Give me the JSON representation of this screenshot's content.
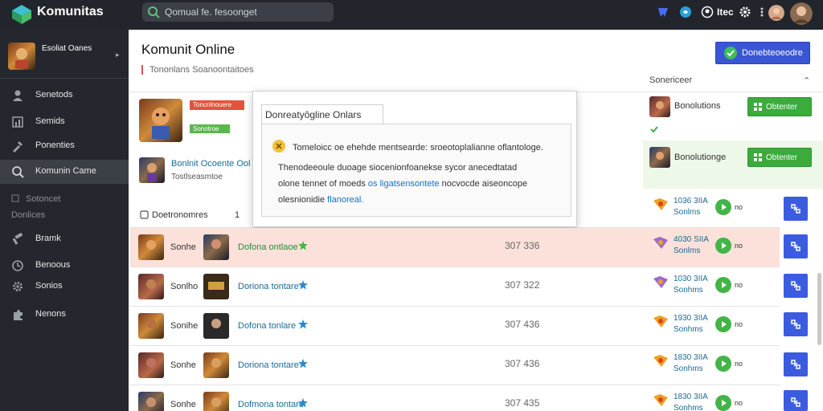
{
  "app": {
    "title": "Komunitas",
    "accent": "#3a56d4"
  },
  "search": {
    "placeholder": "Qomual fe. fesoonget"
  },
  "topbar": {
    "label": "Itec",
    "icons": [
      "logo-icon",
      "search-icon",
      "bookmark-icon",
      "chat-icon",
      "user-icon",
      "gear-icon",
      "avatar"
    ]
  },
  "sidebar": {
    "user": {
      "name": "Esoliat Oanes"
    },
    "items": [
      {
        "label": "Senetods",
        "icon": "person-icon"
      },
      {
        "label": "Semids",
        "icon": "chart-icon"
      },
      {
        "label": "Ponenties",
        "icon": "tools-icon"
      },
      {
        "label": "Komunin Came",
        "icon": "game-icon",
        "active": true
      }
    ],
    "section": {
      "title": "Sotoncet",
      "sub": "Donlices"
    },
    "items2": [
      {
        "label": "Bramk",
        "icon": "hammer-icon"
      },
      {
        "label": "Benoous",
        "icon": "clock-icon"
      },
      {
        "label": "Sonios",
        "icon": "gear-icon"
      },
      {
        "label": "Nenons",
        "icon": "puzzle-icon"
      }
    ]
  },
  "main": {
    "title": "Komunit Online",
    "subtitle": "Tononlans Soanoontaitoes",
    "primary_button": "Donebteoeodre",
    "right_label": "Sonericeer",
    "featured": {
      "badge1": "Toncnlnouere",
      "badge2": "Sonotroe",
      "title2": "Bonlnit Ocoente Ool",
      "sub2": "Tostlseasmtoe",
      "filter_label": "Doetronomres",
      "filter_num": "1"
    }
  },
  "popup": {
    "tab": "Donreatyôgline Onlars",
    "line1": "Tomeloicc oe ehehde mentsearde: sroeotoplalianne oflantologe.",
    "line2": "Thenodeeoule duoage siocenionfoanekse sycor anecedtatad",
    "line3_a": "olone tennet of moeds ",
    "line3_link": "os ligatsensontete",
    "line3_b": " nocvocde aiseoncope",
    "line4_a": "olesnionidie ",
    "line4_link": "flanoreal."
  },
  "right_panel": [
    {
      "name": "Bonolutions",
      "button": "Obtenter"
    },
    {
      "name": "Bonolutionge",
      "button": "Obtenter"
    }
  ],
  "rows": [
    {
      "label": "Sonhe",
      "title": "Dofona ontlaoe",
      "num": "307 336",
      "stat1": "4030 SIIA",
      "stat2": "Sonlms",
      "rval": "no",
      "highlight": true
    },
    {
      "label": "Sonlho",
      "title": "Doriona tontare",
      "num": "307 322",
      "stat1": "1030 3IIA",
      "stat2": "Sonhms",
      "rval": "no",
      "highlight": false
    },
    {
      "label": "Sonihe",
      "title": "Dofona tonlare",
      "num": "307 436",
      "stat1": "1930 3IIA",
      "stat2": "Sonhms",
      "rval": "no",
      "highlight": false
    },
    {
      "label": "Sonhe",
      "title": "Doriona tontare",
      "num": "307 436",
      "stat1": "1830 3IIA",
      "stat2": "Sonhms",
      "rval": "no",
      "highlight": false
    },
    {
      "label": "Sonhe",
      "title": "Dofmona tontare",
      "num": "307 435",
      "stat1": "1830 3IIA",
      "stat2": "Sonhms",
      "rval": "no",
      "highlight": false
    }
  ],
  "top_rows": [
    {
      "stat1": "1036 3IIA",
      "stat2": "Sonlms",
      "rval": "no"
    }
  ]
}
